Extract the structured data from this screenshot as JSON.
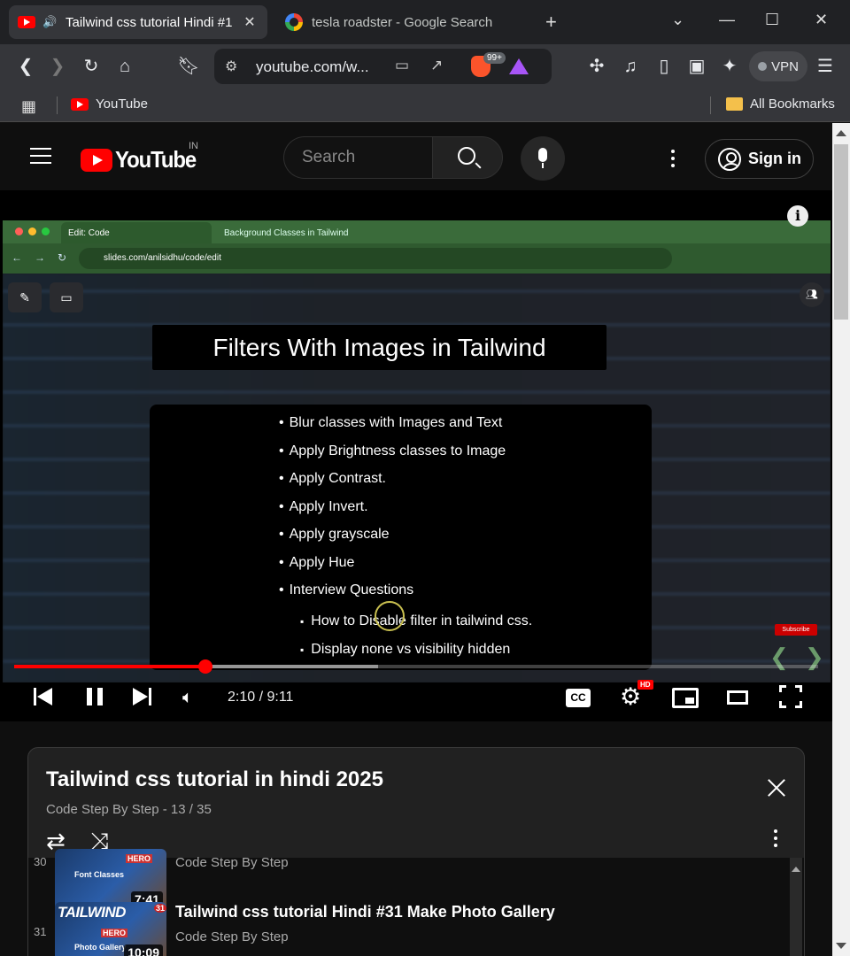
{
  "browser": {
    "tabs": [
      {
        "label": "Tailwind css tutorial Hindi #1",
        "active": true
      },
      {
        "label": "tesla roadster - Google Search",
        "active": false
      }
    ],
    "new_tab": "+",
    "window_controls": {
      "dropdown": "⌄",
      "minimize": "—",
      "maximize": "☐",
      "close": "✕"
    },
    "address": "youtube.com/w...",
    "extension_badge": "99+",
    "vpn_label": "VPN",
    "bookmarks": {
      "youtube": "YouTube",
      "all": "All Bookmarks"
    }
  },
  "youtube": {
    "logo_text": "YouTube",
    "country_code": "IN",
    "search_placeholder": "Search",
    "signin_label": "Sign in"
  },
  "player": {
    "slide": {
      "title": "Filters With Images in Tailwind",
      "bullets": [
        "Blur classes with Images and Text",
        "Apply Brightness classes to Image",
        "Apply Contrast.",
        "Apply Invert.",
        "Apply grayscale",
        "Apply Hue",
        "Interview Questions"
      ],
      "sub_bullets": [
        "How to Disable filter in tailwind css.",
        "Display none vs visibility hidden"
      ]
    },
    "inner_browser": {
      "tab1": "Edit: Code",
      "tab2": "Background Classes in Tailwind",
      "url": "slides.com/anilsidhu/code/edit"
    },
    "subscribe_mini": "Subscribe",
    "time": "2:10 / 9:11",
    "progress_fraction": 0.238,
    "buffer_fraction": 0.453,
    "hd_badge": "HD",
    "cc_label": "CC",
    "info_label": "i"
  },
  "playlist": {
    "title": "Tailwind css tutorial in hindi 2025",
    "subtitle": "Code Step By Step - 13 / 35",
    "items": [
      {
        "index": "30",
        "title": "",
        "channel": "Code Step By Step",
        "duration": "7:41",
        "thumb_text": "Font Classes",
        "thumb_badge": "HERO"
      },
      {
        "index": "31",
        "title": "Tailwind css tutorial Hindi #31 Make Photo Gallery",
        "channel": "Code Step By Step",
        "duration": "10:09",
        "thumb_text": "Photo Gallery",
        "thumb_badge": "HERO",
        "thumb_big": "TAILWIND",
        "thumb_num": "31"
      }
    ]
  },
  "colors": {
    "accent": "#ff0000",
    "bg": "#0f0f0f",
    "panel": "#212121"
  }
}
